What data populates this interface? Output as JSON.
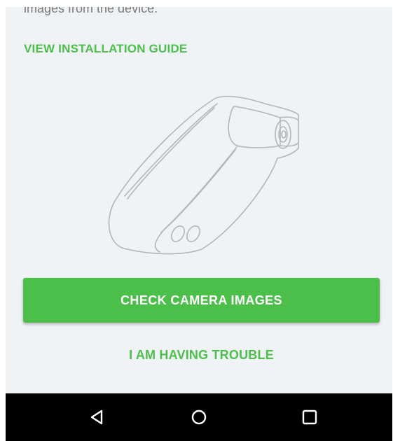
{
  "content": {
    "body_text": "images from the device.",
    "guide_link": "VIEW INSTALLATION GUIDE"
  },
  "actions": {
    "primary_label": "CHECK CAMERA IMAGES",
    "secondary_label": "I AM HAVING TROUBLE"
  },
  "illustration": {
    "icon": "dash-camera-illustration"
  },
  "navbar": {
    "buttons": [
      "back-icon",
      "home-icon",
      "recents-icon"
    ]
  },
  "colors": {
    "accent": "#4cbf4b",
    "background": "#f0f3f6",
    "navbar": "#000000",
    "line_art": "#b3b6b8"
  }
}
